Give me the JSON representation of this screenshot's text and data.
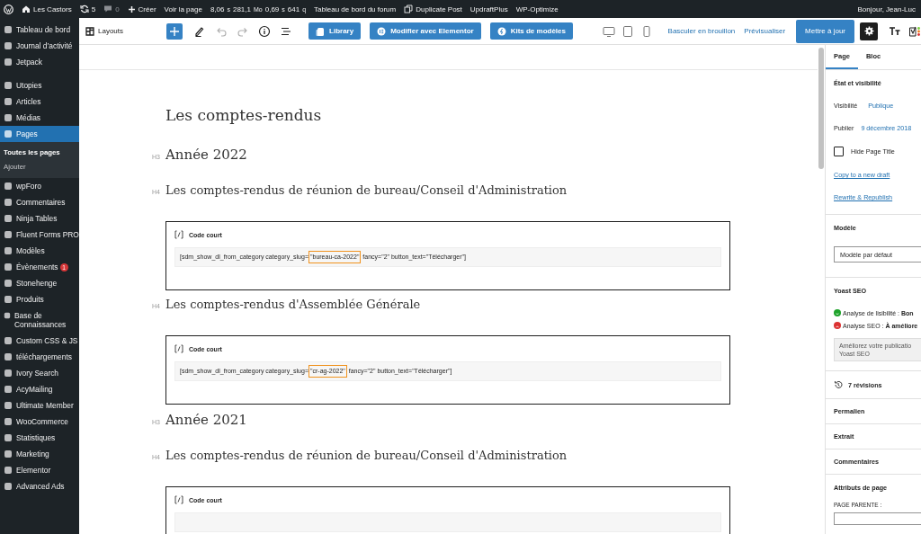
{
  "admin_bar": {
    "items": [
      {
        "kind": "logo"
      },
      {
        "kind": "site",
        "label": "Les Castors"
      },
      {
        "kind": "updates",
        "label": "5"
      },
      {
        "kind": "comments",
        "label": "0"
      },
      {
        "kind": "new",
        "label": "Créer"
      },
      {
        "kind": "text",
        "label": "Voir la page"
      },
      {
        "kind": "perf",
        "parts": [
          {
            "value": "8,06",
            "unit": "s"
          },
          {
            "value": "281,1",
            "unit": "Mo"
          },
          {
            "value": "0,69",
            "unit": "s"
          },
          {
            "value": "641",
            "unit": "q"
          }
        ]
      },
      {
        "kind": "text",
        "label": "Tableau de bord du forum"
      },
      {
        "kind": "duplicate",
        "label": "Duplicate Post"
      },
      {
        "kind": "text",
        "label": "UpdraftPlus"
      },
      {
        "kind": "text",
        "label": "WP-Optimize"
      }
    ],
    "greeting": "Bonjour, Jean-Luc"
  },
  "sidebar": {
    "items": [
      {
        "label": "Tableau de bord",
        "selected": false
      },
      {
        "label": "Journal d’activité",
        "selected": false
      },
      {
        "label": "Jetpack",
        "selected": false
      },
      {
        "kind": "separator"
      },
      {
        "label": "Utopies",
        "selected": false
      },
      {
        "label": "Articles",
        "selected": false
      },
      {
        "label": "Médias",
        "selected": false
      },
      {
        "label": "Pages",
        "selected": true,
        "children": [
          {
            "label": "Toutes les pages",
            "selected": true
          },
          {
            "label": "Ajouter",
            "selected": false
          }
        ]
      },
      {
        "label": "wpForo",
        "selected": false
      },
      {
        "label": "Commentaires",
        "selected": false
      },
      {
        "label": "Ninja Tables",
        "selected": false
      },
      {
        "label": "Fluent Forms PRO",
        "selected": false
      },
      {
        "label": "Modèles",
        "selected": false
      },
      {
        "label": "Évènements",
        "selected": false,
        "badge": "1"
      },
      {
        "label": "Stonehenge",
        "selected": false
      },
      {
        "label": "Produits",
        "selected": false
      },
      {
        "label": "Base de Connaissances",
        "selected": false
      },
      {
        "label": "Custom CSS & JS",
        "selected": false
      },
      {
        "label": "téléchargements",
        "selected": false
      },
      {
        "label": "Ivory Search",
        "selected": false
      },
      {
        "label": "AcyMailing",
        "selected": false
      },
      {
        "label": "Ultimate Member",
        "selected": false
      },
      {
        "label": "WooCommerce",
        "selected": false
      },
      {
        "label": "Statistiques",
        "selected": false
      },
      {
        "label": "Marketing",
        "selected": false
      },
      {
        "label": "Elementor",
        "selected": false
      },
      {
        "label": "Advanced Ads",
        "selected": false
      }
    ]
  },
  "toolbar": {
    "layouts": "Layouts",
    "tools": [
      {
        "kind": "add",
        "disabled": false
      },
      {
        "kind": "edit",
        "disabled": false
      },
      {
        "kind": "undo",
        "disabled": true
      },
      {
        "kind": "redo",
        "disabled": true
      },
      {
        "kind": "info",
        "disabled": false
      },
      {
        "kind": "list",
        "disabled": false
      }
    ],
    "buttons": [
      {
        "kind": "library",
        "label": "Library"
      },
      {
        "kind": "elementor",
        "label": "Modifier avec Elementor"
      },
      {
        "kind": "kits",
        "label": "Kits de modèles"
      }
    ],
    "devices": [
      {
        "kind": "desktop"
      },
      {
        "kind": "tablet"
      },
      {
        "kind": "mobile"
      }
    ],
    "draft_link": "Basculer en brouillon",
    "preview_link": "Prévisualiser",
    "update_button": "Mettre à jour",
    "settings_active": true
  },
  "document": {
    "title": "Les comptes-rendus",
    "blocks": [
      {
        "kind": "heading",
        "level": "H3",
        "text": "Année 2022"
      },
      {
        "kind": "heading",
        "level": "H4",
        "text": "Les comptes-rendus de réunion de bureau/Conseil d'Administration"
      },
      {
        "kind": "shortcode",
        "label": "Code court",
        "prefix": "[sdm_show_dl_from_category category_slug=",
        "highlight": "\"bureau-ca-2022\"",
        "suffix": " fancy=\"2\" button_text=\"Télécharger\"]"
      },
      {
        "kind": "heading",
        "level": "H4",
        "text": "Les comptes-rendus d'Assemblée Générale"
      },
      {
        "kind": "shortcode",
        "label": "Code court",
        "prefix": "[sdm_show_dl_from_category category_slug=",
        "highlight": "\"cr-ag-2022\"",
        "suffix": " fancy=\"2\" button_text=\"Télécharger\"]"
      },
      {
        "kind": "heading",
        "level": "H3",
        "text": "Année 2021"
      },
      {
        "kind": "heading",
        "level": "H4",
        "text": "Les comptes-rendus de réunion de bureau/Conseil d'Administration"
      },
      {
        "kind": "shortcode",
        "label": "Code court"
      }
    ]
  },
  "settings": {
    "tabs": [
      {
        "label": "Page",
        "selected": true
      },
      {
        "label": "Bloc",
        "selected": false
      }
    ],
    "status": {
      "title": "État et visibilité",
      "visibility_label": "Visibilité",
      "visibility": "Publique",
      "publish_label": "Publier",
      "publish_date": "9 décembre 2018",
      "hide_title": {
        "label": "Hide Page Title",
        "checked": false
      },
      "links": [
        "Copy to a new draft",
        "Rewrite & Republish"
      ]
    },
    "template": {
      "title": "Modèle",
      "value": "Modèle par défaut"
    },
    "yoast": {
      "title": "Yoast SEO",
      "analyses": [
        {
          "label": "Analyse de lisibilité : ",
          "result": "Bon",
          "color": "#1ea32a"
        },
        {
          "label": "Analyse SEO : ",
          "result": "À améliore",
          "color": "#dc3232"
        }
      ],
      "note_lines": [
        "Améliorez votre publicatio",
        "Yoast SEO"
      ]
    },
    "revisions": "7 révisions",
    "panels": [
      "Permalien",
      "Extrait",
      "Commentaires"
    ],
    "attributes": {
      "title": "Attributs de page",
      "parent_label": "PAGE PARENTE :"
    }
  }
}
